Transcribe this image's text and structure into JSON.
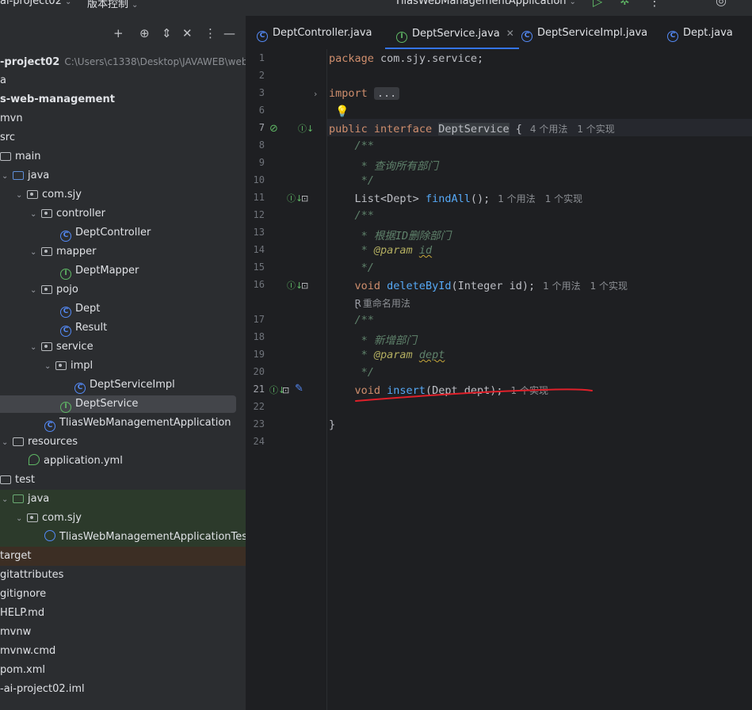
{
  "topbar": {
    "project": "ai-project02",
    "vcs": "版本控制",
    "run_config": "TliasWebManagementApplication"
  },
  "project_panel": {
    "rows": [
      {
        "label": "-project02",
        "path": "C:\\Users\\c1338\\Desktop\\JAVAWEB\\web-ai"
      },
      {
        "label": "a"
      },
      {
        "label": "s-web-management"
      },
      {
        "label": "mvn"
      },
      {
        "label": "src"
      },
      {
        "label": "main"
      },
      {
        "label": "java"
      },
      {
        "label": "com.sjy"
      },
      {
        "label": "controller"
      },
      {
        "label": "DeptController"
      },
      {
        "label": "mapper"
      },
      {
        "label": "DeptMapper"
      },
      {
        "label": "pojo"
      },
      {
        "label": "Dept"
      },
      {
        "label": "Result"
      },
      {
        "label": "service"
      },
      {
        "label": "impl"
      },
      {
        "label": "DeptServiceImpl"
      },
      {
        "label": "DeptService"
      },
      {
        "label": "TliasWebManagementApplication"
      },
      {
        "label": "resources"
      },
      {
        "label": "application.yml"
      },
      {
        "label": "test"
      },
      {
        "label": "java"
      },
      {
        "label": "com.sjy"
      },
      {
        "label": "TliasWebManagementApplicationTests"
      },
      {
        "label": "target"
      },
      {
        "label": "gitattributes"
      },
      {
        "label": "gitignore"
      },
      {
        "label": "HELP.md"
      },
      {
        "label": "mvnw"
      },
      {
        "label": "mvnw.cmd"
      },
      {
        "label": "pom.xml"
      },
      {
        "label": "-ai-project02.iml"
      }
    ]
  },
  "tabs": [
    {
      "label": "DeptController.java"
    },
    {
      "label": "DeptService.java"
    },
    {
      "label": "DeptServiceImpl.java"
    },
    {
      "label": "Dept.java"
    }
  ],
  "editor": {
    "line_numbers": [
      "1",
      "2",
      "3",
      "6",
      "7",
      "8",
      "9",
      "10",
      "11",
      "12",
      "13",
      "14",
      "15",
      "16",
      "17",
      "18",
      "19",
      "20",
      "21",
      "22",
      "23",
      "24"
    ],
    "pkg": "com.sjy.service",
    "fold_text": "...",
    "iface_name": "DeptService",
    "hint_usages_4": "4 个用法",
    "hint_impl": "1 个实现",
    "hint_usages_1": "1 个用法",
    "comment_findall": "* 查询所有部门",
    "findall_type": "List<Dept>",
    "findall_name": "findAll",
    "comment_delete": "* 根据ID删除部门",
    "param_id": "id",
    "delete_name": "deleteById",
    "delete_args": "(Integer id);",
    "rename_hint": "重命名用法",
    "comment_insert": "* 新增部门",
    "param_dept": "dept",
    "insert_name": "insert",
    "insert_args": "(Dept dept);"
  },
  "colors": {
    "accent": "#3574f0",
    "annotation_red": "#e0202a"
  }
}
